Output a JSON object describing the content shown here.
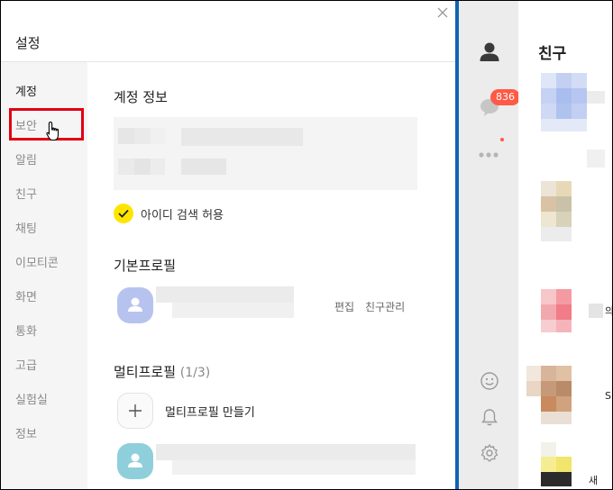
{
  "settings": {
    "title": "설정",
    "close_icon": "close-icon",
    "sidebar": {
      "items": [
        {
          "label": "계정",
          "active": true
        },
        {
          "label": "보안",
          "active": false
        },
        {
          "label": "알림",
          "active": false
        },
        {
          "label": "친구",
          "active": false
        },
        {
          "label": "채팅",
          "active": false
        },
        {
          "label": "이모티콘",
          "active": false
        },
        {
          "label": "화면",
          "active": false
        },
        {
          "label": "통화",
          "active": false
        },
        {
          "label": "고급",
          "active": false
        },
        {
          "label": "실험실",
          "active": false
        },
        {
          "label": "정보",
          "active": false
        }
      ]
    },
    "account": {
      "section_title": "계정 정보",
      "allow_id_search_label": "아이디 검색 허용",
      "allow_id_search_checked": true
    },
    "basic_profile": {
      "section_title": "기본프로필",
      "edit_label": "편집",
      "friend_manage_label": "친구관리"
    },
    "multi_profile": {
      "section_title": "멀티프로필",
      "count": "(1/3)",
      "create_label": "멀티프로필 만들기"
    }
  },
  "messenger": {
    "rail": {
      "chat_badge": "836",
      "icons": [
        "person-icon",
        "chat-bubble-icon",
        "more-dots-icon",
        "emoji-icon",
        "bell-icon",
        "gear-icon"
      ]
    },
    "friends": {
      "title": "친구",
      "partial_texts": [
        "의",
        "S",
        "새"
      ]
    }
  },
  "colors": {
    "highlight": "#e00012",
    "checkbox": "#fee500",
    "badge": "#ff5a45",
    "divider": "#0f63b3"
  }
}
